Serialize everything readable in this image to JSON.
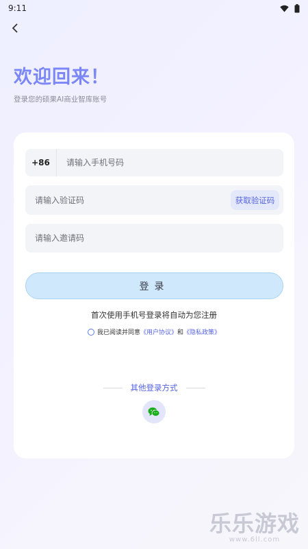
{
  "status_bar": {
    "time": "9:11"
  },
  "header": {
    "title": "欢迎回来！",
    "subtitle": "登录您的硕果AI商业智库账号"
  },
  "form": {
    "country_code": "+86",
    "phone_placeholder": "请输入手机号码",
    "code_placeholder": "请输入验证码",
    "get_code_label": "获取验证码",
    "invite_placeholder": "请输入邀请码",
    "login_label": "登录"
  },
  "notes": {
    "auto_register": "首次使用手机号登录将自动为您注册",
    "agree_prefix": "我已阅读并同意",
    "user_agreement": "《用户协议》",
    "and": "和",
    "privacy_policy": "《隐私政策》"
  },
  "other_login": {
    "label": "其他登录方式",
    "icon": "wechat-icon"
  },
  "watermark": {
    "text": "乐乐游戏",
    "url": "www.6ll.com"
  },
  "colors": {
    "accent": "#7b86f7",
    "link": "#5664e3",
    "login_button": "#cfe8fc"
  }
}
